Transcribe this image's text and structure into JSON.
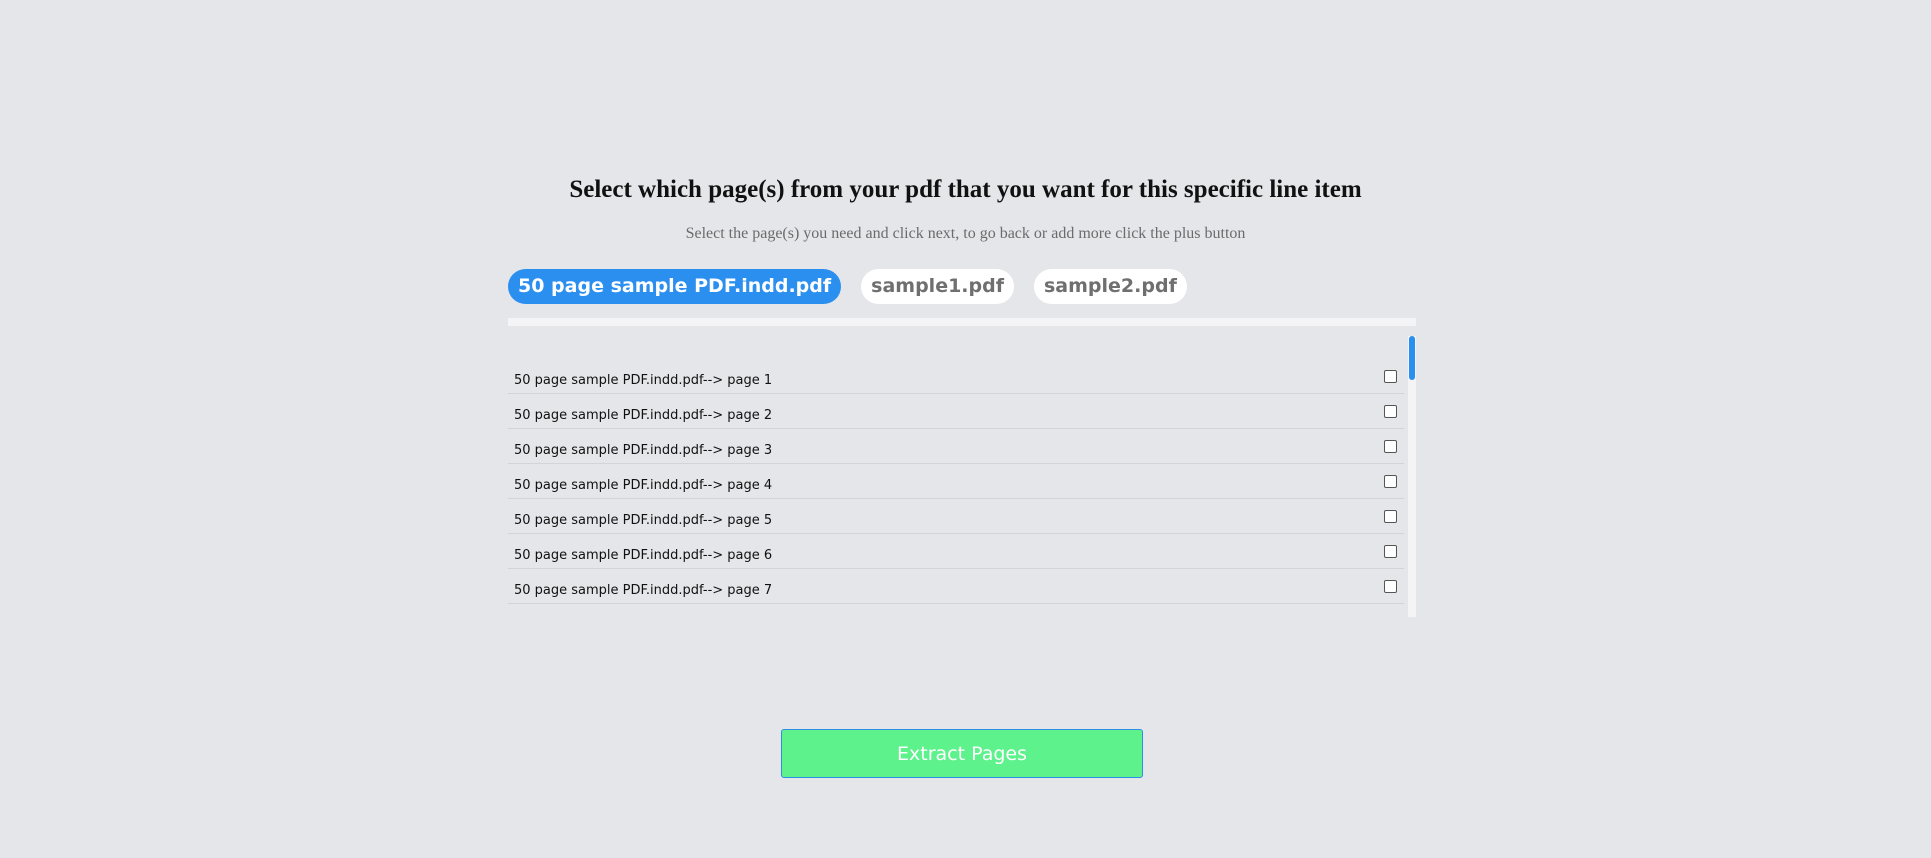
{
  "header": {
    "title": "Select which page(s) from your pdf that you want for this specific line item",
    "subtitle": "Select the page(s) you need and click next, to go back or add more click the plus button"
  },
  "tabs": [
    {
      "label": "50 page sample PDF.indd.pdf",
      "active": true
    },
    {
      "label": "sample1.pdf",
      "active": false
    },
    {
      "label": "sample2.pdf",
      "active": false
    }
  ],
  "pages": [
    {
      "label": "50 page sample PDF.indd.pdf--> page 1",
      "checked": false
    },
    {
      "label": "50 page sample PDF.indd.pdf--> page 2",
      "checked": false
    },
    {
      "label": "50 page sample PDF.indd.pdf--> page 3",
      "checked": false
    },
    {
      "label": "50 page sample PDF.indd.pdf--> page 4",
      "checked": false
    },
    {
      "label": "50 page sample PDF.indd.pdf--> page 5",
      "checked": false
    },
    {
      "label": "50 page sample PDF.indd.pdf--> page 6",
      "checked": false
    },
    {
      "label": "50 page sample PDF.indd.pdf--> page 7",
      "checked": false
    }
  ],
  "actions": {
    "extract_label": "Extract Pages"
  },
  "colors": {
    "background": "#e5e6ea",
    "accent": "#2b8ff0",
    "button": "#5ef28c"
  }
}
